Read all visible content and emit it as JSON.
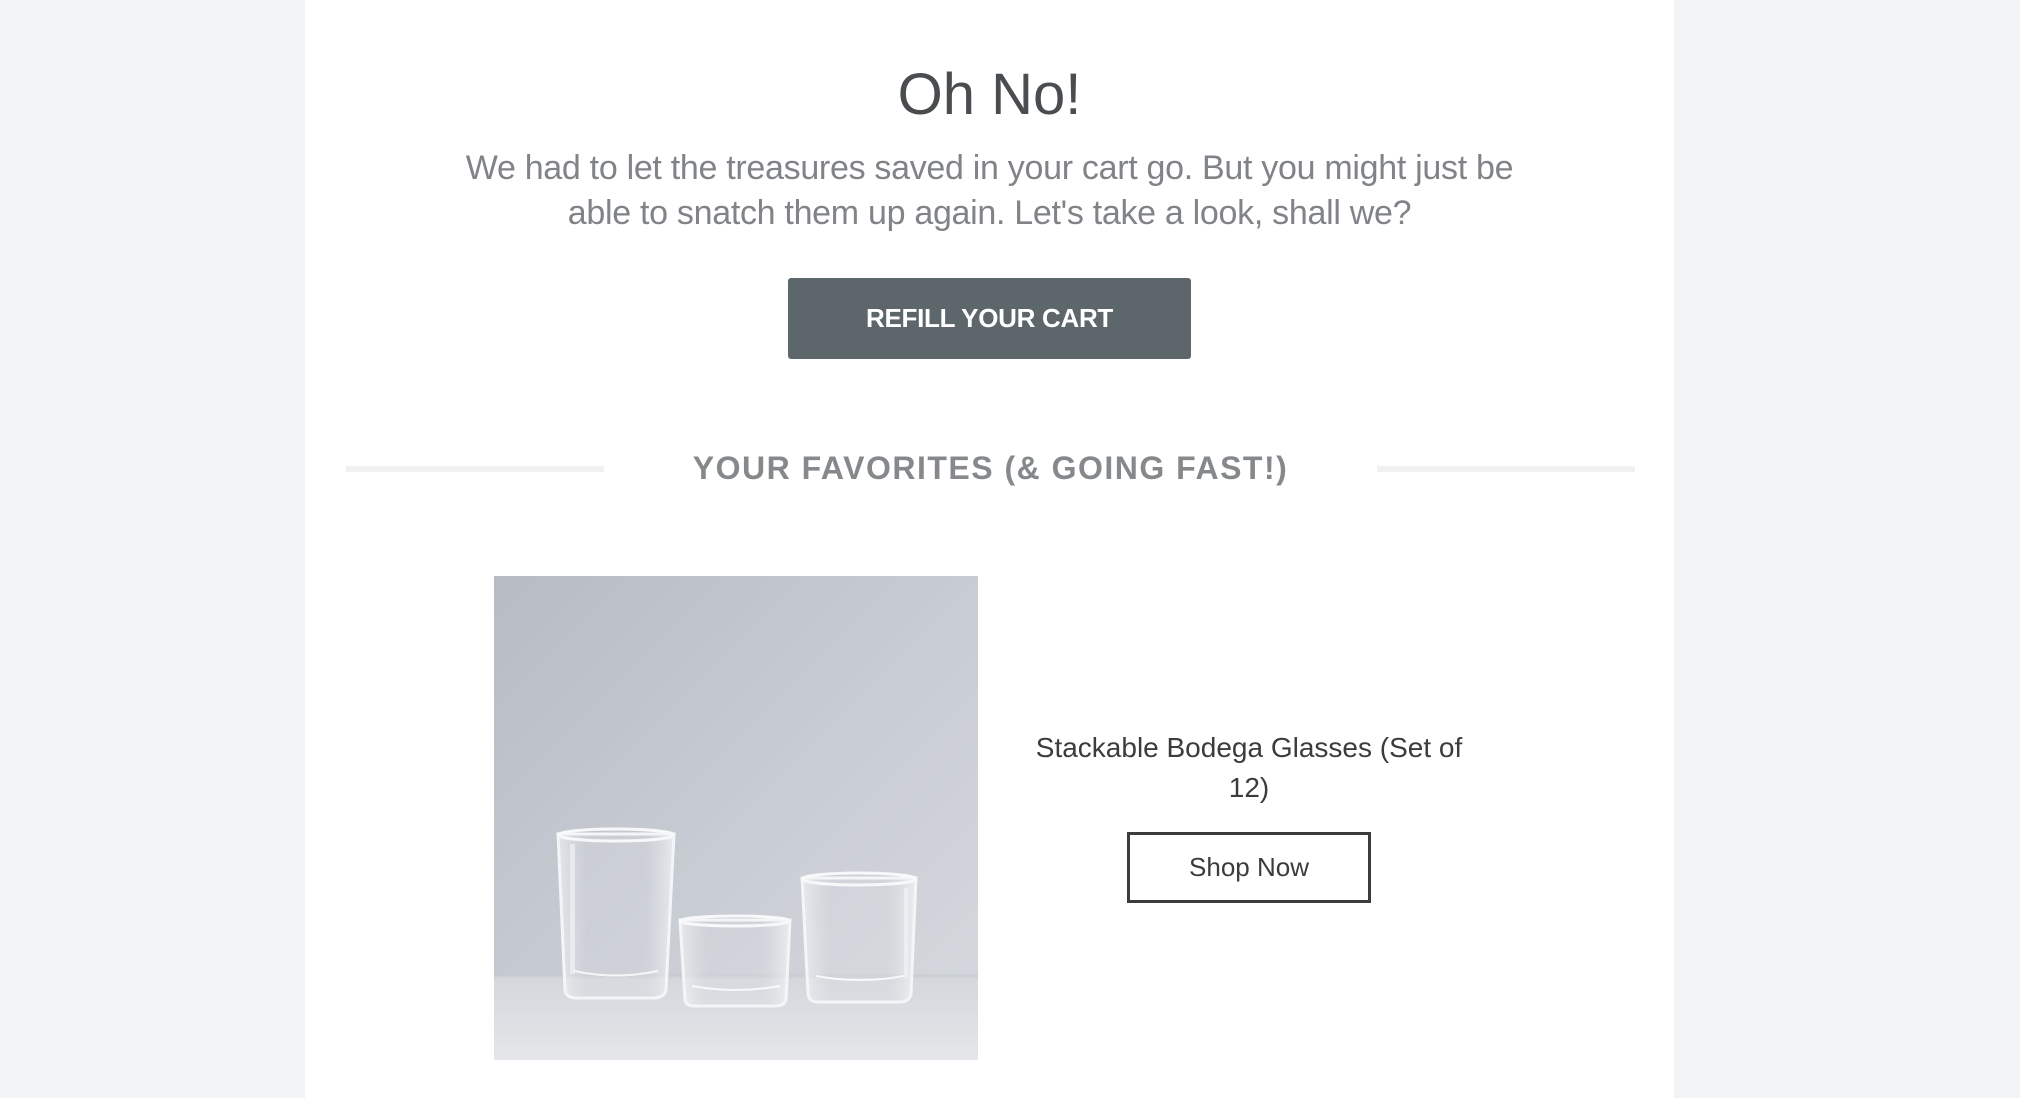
{
  "email": {
    "headline": "Oh No!",
    "intro": "We had to let the treasures saved in your cart go. But you might just be able to snatch them up again. Let's take a look, shall we?",
    "refill_button": "REFILL YOUR CART",
    "section_title": "YOUR FAVORITES (& GOING FAST!)"
  },
  "product": {
    "name": "Stackable Bodega Glasses (Set of 12)",
    "shop_button": "Shop Now",
    "image": "glass-tumblers-photo"
  },
  "colors": {
    "page_background": "#f2f3f5",
    "card_background": "#ffffff",
    "button_fill": "#5c666b",
    "headline_text": "#4a4d50",
    "body_text": "#808387"
  }
}
